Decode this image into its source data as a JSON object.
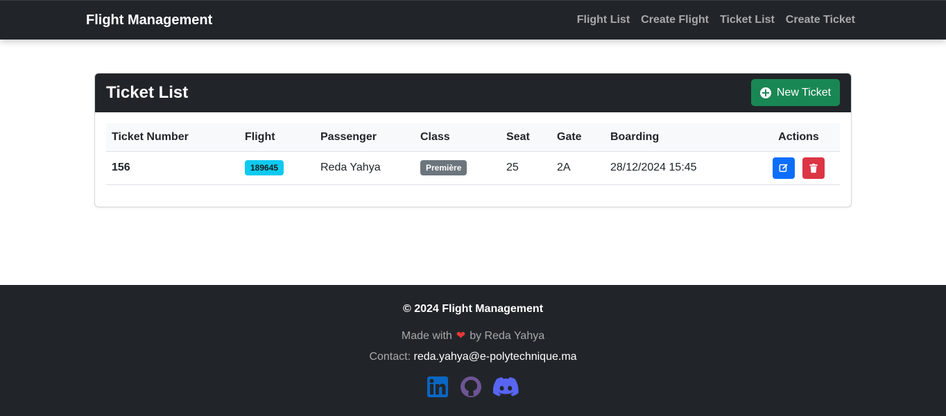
{
  "navbar": {
    "brand": "Flight Management",
    "links": [
      "Flight List",
      "Create Flight",
      "Ticket List",
      "Create Ticket"
    ]
  },
  "card": {
    "title": "Ticket List",
    "new_button": "New Ticket"
  },
  "table": {
    "headers": [
      "Ticket Number",
      "Flight",
      "Passenger",
      "Class",
      "Seat",
      "Gate",
      "Boarding",
      "Actions"
    ],
    "rows": [
      {
        "ticket_number": "156",
        "flight": "189645",
        "passenger": "Reda Yahya",
        "class": "Première",
        "seat": "25",
        "gate": "2A",
        "boarding": "28/12/2024 15:45"
      }
    ]
  },
  "footer": {
    "copyright": "© 2024 Flight Management",
    "made_prefix": "Made with",
    "made_suffix": "by Reda Yahya",
    "contact_label": "Contact:",
    "email": "reda.yahya@e-polytechnique.ma",
    "socials": [
      "linkedin-icon",
      "github-icon",
      "discord-icon"
    ]
  },
  "colors": {
    "dark": "#212529",
    "success": "#198754",
    "info": "#0dcaf0",
    "secondary": "#6c757d",
    "primary": "#0d6efd",
    "danger": "#dc3545"
  }
}
